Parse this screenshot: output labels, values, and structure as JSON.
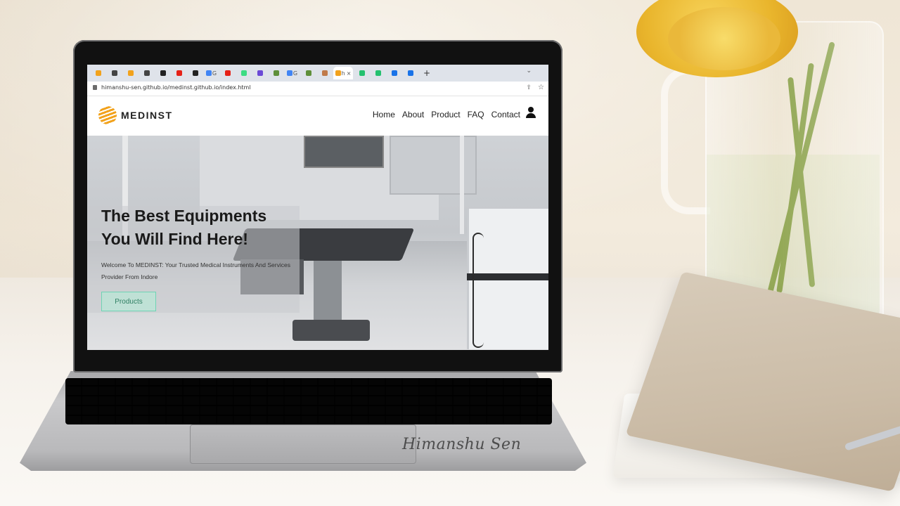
{
  "browser": {
    "tabs": [
      {
        "label": "",
        "icon": "c-icon",
        "color": "#f2a21c"
      },
      {
        "label": "",
        "icon": "pen-icon",
        "color": "#444444"
      },
      {
        "label": "",
        "icon": "c-icon",
        "color": "#f2a21c"
      },
      {
        "label": "",
        "icon": "pen-icon",
        "color": "#444444"
      },
      {
        "label": "",
        "icon": "github-icon",
        "color": "#222222"
      },
      {
        "label": "",
        "icon": "youtube-icon",
        "color": "#e62117"
      },
      {
        "label": "",
        "icon": "github-icon",
        "color": "#222222"
      },
      {
        "label": "G",
        "icon": "google-icon",
        "color": "#4285f4"
      },
      {
        "label": "",
        "icon": "youtube-icon",
        "color": "#e62117"
      },
      {
        "label": "",
        "icon": "android-icon",
        "color": "#3ddc84"
      },
      {
        "label": "",
        "icon": "square-icon",
        "color": "#6b4ad6"
      },
      {
        "label": "",
        "icon": "tab-icon",
        "color": "#5f8f3a"
      },
      {
        "label": "G",
        "icon": "google-icon",
        "color": "#4285f4"
      },
      {
        "label": "",
        "icon": "tab-icon",
        "color": "#5f8f3a"
      },
      {
        "label": "",
        "icon": "avatar-icon",
        "color": "#c07a4a"
      },
      {
        "label": "h",
        "icon": "medinst-icon",
        "color": "#f2a21c",
        "active": true
      },
      {
        "label": "",
        "icon": "tab-icon",
        "color": "#25c16f"
      },
      {
        "label": "",
        "icon": "tab-icon",
        "color": "#25c16f"
      },
      {
        "label": "",
        "icon": "chrome-icon",
        "color": "#1a73e8"
      },
      {
        "label": "",
        "icon": "chrome-icon",
        "color": "#1a73e8"
      }
    ],
    "new_tab_label": "+",
    "tab_menu": "⌄",
    "url": "himanshu-sen.github.io/medinst.github.io/index.html"
  },
  "site": {
    "brand": "MEDINST",
    "menu": [
      "Home",
      "About",
      "Product",
      "FAQ",
      "Contact"
    ],
    "hero": {
      "title": "The Best Equipments You Will Find Here!",
      "subtitle": "Welcome To MEDINST: Your Trusted Medical Instruments And Services Provider From Indore",
      "button": "Products"
    }
  },
  "watermark": "Himanshu Sen",
  "colors": {
    "accent": "#f2a21c",
    "button_border": "#6fd4b4",
    "button_text": "#2f7f64"
  }
}
